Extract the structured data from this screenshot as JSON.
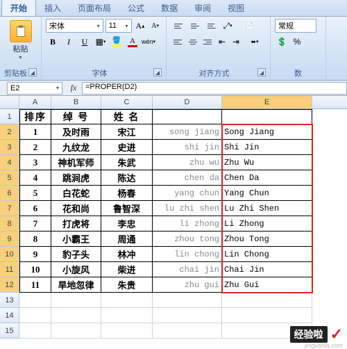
{
  "tabs": [
    "开始",
    "插入",
    "页面布局",
    "公式",
    "数据",
    "审阅",
    "视图"
  ],
  "active_tab": 0,
  "clipboard": {
    "paste": "粘贴",
    "group": "剪贴板"
  },
  "font": {
    "name": "宋体",
    "size": "11",
    "group": "字体",
    "B": "B",
    "I": "I",
    "U": "U"
  },
  "align": {
    "group": "对齐方式"
  },
  "number": {
    "group": "数",
    "format": "常规"
  },
  "name_box": "E2",
  "formula": "=PROPER(D2)",
  "col_letters": [
    "A",
    "B",
    "C",
    "D",
    "E"
  ],
  "headers": [
    "排序",
    "绰 号",
    "姓  名",
    "",
    ""
  ],
  "rows": [
    {
      "n": "1",
      "nick": "及时雨",
      "name": "宋江",
      "py": "song jiang",
      "proper": "Song Jiang"
    },
    {
      "n": "2",
      "nick": "九纹龙",
      "name": "史进",
      "py": "shi jin",
      "proper": "Shi Jin"
    },
    {
      "n": "3",
      "nick": "神机军师",
      "name": "朱武",
      "py": "zhu wu",
      "proper": "Zhu Wu"
    },
    {
      "n": "4",
      "nick": "跳涧虎",
      "name": "陈达",
      "py": "chen da",
      "proper": "Chen Da"
    },
    {
      "n": "5",
      "nick": "白花蛇",
      "name": "杨春",
      "py": "yang chun",
      "proper": "Yang Chun"
    },
    {
      "n": "6",
      "nick": "花和尚",
      "name": "鲁智深",
      "py": "lu zhi shen",
      "proper": "Lu Zhi Shen"
    },
    {
      "n": "7",
      "nick": "打虎将",
      "name": "李忠",
      "py": "li zhong",
      "proper": "Li Zhong"
    },
    {
      "n": "8",
      "nick": "小霸王",
      "name": "周通",
      "py": "zhou tong",
      "proper": "Zhou Tong"
    },
    {
      "n": "9",
      "nick": "豹子头",
      "name": "林冲",
      "py": "lin chong",
      "proper": "Lin Chong"
    },
    {
      "n": "10",
      "nick": "小旋风",
      "name": "柴进",
      "py": "chai jin",
      "proper": "Chai Jin"
    },
    {
      "n": "11",
      "nick": "旱地忽律",
      "name": "朱贵",
      "py": "zhu gui",
      "proper": "Zhu Gui"
    }
  ],
  "extra_rows": [
    "13",
    "14",
    "15"
  ],
  "watermark": {
    "text": "经验啦",
    "url": "jingyanla.com"
  }
}
